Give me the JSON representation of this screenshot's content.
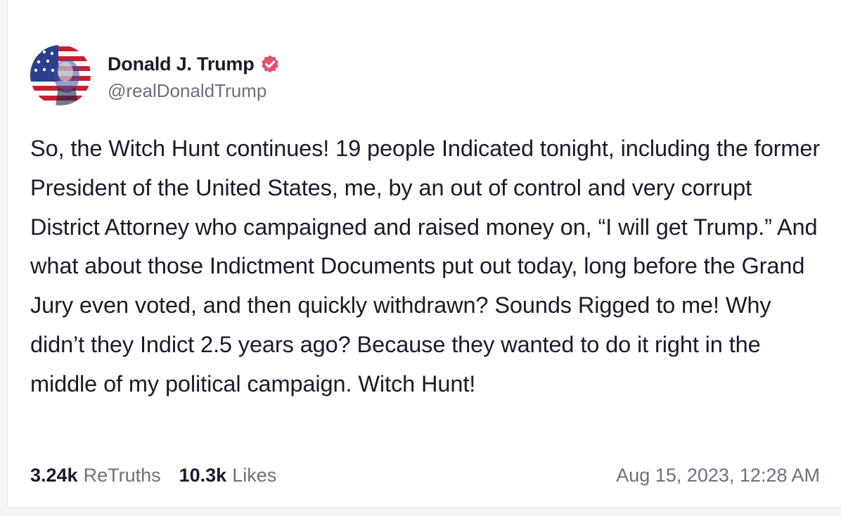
{
  "post": {
    "author": {
      "display_name": "Donald J. Trump",
      "handle": "@realDonaldTrump",
      "verified": true
    },
    "text": "So, the Witch Hunt continues! 19 people Indicated tonight, including the former President of the United States, me, by an out of control and very corrupt District Attorney who campaigned and raised money on, “I will get Trump.” And what about those Indictment Documents put out today, long before the Grand Jury even voted, and then quickly withdrawn? Sounds Rigged to me! Why didn’t they Indict 2.5 years ago? Because they wanted to do it right in the middle of my political campaign. Witch Hunt!",
    "stats": {
      "retruths_count": "3.24k",
      "retruths_label": "ReTruths",
      "likes_count": "10.3k",
      "likes_label": "Likes"
    },
    "timestamp": "Aug 15, 2023, 12:28 AM"
  },
  "icons": {
    "avatar": "flag-portrait-avatar",
    "verified": "verified-badge-icon"
  },
  "colors": {
    "verified_badge": "#e6506e",
    "text_primary": "#1a1a2e",
    "text_secondary": "#6b7080"
  }
}
